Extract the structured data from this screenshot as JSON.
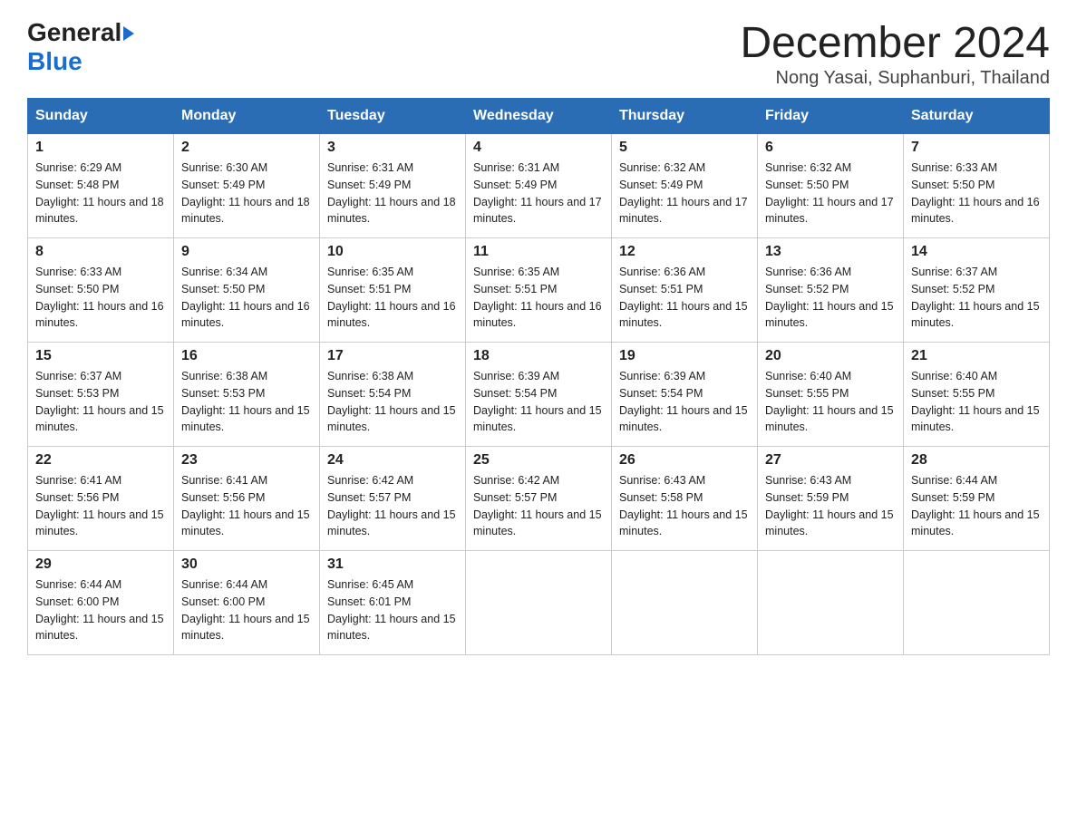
{
  "header": {
    "logo": {
      "general": "General",
      "blue": "Blue",
      "arrow": "▶"
    },
    "month_title": "December 2024",
    "location": "Nong Yasai, Suphanburi, Thailand"
  },
  "weekdays": [
    "Sunday",
    "Monday",
    "Tuesday",
    "Wednesday",
    "Thursday",
    "Friday",
    "Saturday"
  ],
  "weeks": [
    [
      {
        "day": "1",
        "sunrise": "6:29 AM",
        "sunset": "5:48 PM",
        "daylight": "11 hours and 18 minutes."
      },
      {
        "day": "2",
        "sunrise": "6:30 AM",
        "sunset": "5:49 PM",
        "daylight": "11 hours and 18 minutes."
      },
      {
        "day": "3",
        "sunrise": "6:31 AM",
        "sunset": "5:49 PM",
        "daylight": "11 hours and 18 minutes."
      },
      {
        "day": "4",
        "sunrise": "6:31 AM",
        "sunset": "5:49 PM",
        "daylight": "11 hours and 17 minutes."
      },
      {
        "day": "5",
        "sunrise": "6:32 AM",
        "sunset": "5:49 PM",
        "daylight": "11 hours and 17 minutes."
      },
      {
        "day": "6",
        "sunrise": "6:32 AM",
        "sunset": "5:50 PM",
        "daylight": "11 hours and 17 minutes."
      },
      {
        "day": "7",
        "sunrise": "6:33 AM",
        "sunset": "5:50 PM",
        "daylight": "11 hours and 16 minutes."
      }
    ],
    [
      {
        "day": "8",
        "sunrise": "6:33 AM",
        "sunset": "5:50 PM",
        "daylight": "11 hours and 16 minutes."
      },
      {
        "day": "9",
        "sunrise": "6:34 AM",
        "sunset": "5:50 PM",
        "daylight": "11 hours and 16 minutes."
      },
      {
        "day": "10",
        "sunrise": "6:35 AM",
        "sunset": "5:51 PM",
        "daylight": "11 hours and 16 minutes."
      },
      {
        "day": "11",
        "sunrise": "6:35 AM",
        "sunset": "5:51 PM",
        "daylight": "11 hours and 16 minutes."
      },
      {
        "day": "12",
        "sunrise": "6:36 AM",
        "sunset": "5:51 PM",
        "daylight": "11 hours and 15 minutes."
      },
      {
        "day": "13",
        "sunrise": "6:36 AM",
        "sunset": "5:52 PM",
        "daylight": "11 hours and 15 minutes."
      },
      {
        "day": "14",
        "sunrise": "6:37 AM",
        "sunset": "5:52 PM",
        "daylight": "11 hours and 15 minutes."
      }
    ],
    [
      {
        "day": "15",
        "sunrise": "6:37 AM",
        "sunset": "5:53 PM",
        "daylight": "11 hours and 15 minutes."
      },
      {
        "day": "16",
        "sunrise": "6:38 AM",
        "sunset": "5:53 PM",
        "daylight": "11 hours and 15 minutes."
      },
      {
        "day": "17",
        "sunrise": "6:38 AM",
        "sunset": "5:54 PM",
        "daylight": "11 hours and 15 minutes."
      },
      {
        "day": "18",
        "sunrise": "6:39 AM",
        "sunset": "5:54 PM",
        "daylight": "11 hours and 15 minutes."
      },
      {
        "day": "19",
        "sunrise": "6:39 AM",
        "sunset": "5:54 PM",
        "daylight": "11 hours and 15 minutes."
      },
      {
        "day": "20",
        "sunrise": "6:40 AM",
        "sunset": "5:55 PM",
        "daylight": "11 hours and 15 minutes."
      },
      {
        "day": "21",
        "sunrise": "6:40 AM",
        "sunset": "5:55 PM",
        "daylight": "11 hours and 15 minutes."
      }
    ],
    [
      {
        "day": "22",
        "sunrise": "6:41 AM",
        "sunset": "5:56 PM",
        "daylight": "11 hours and 15 minutes."
      },
      {
        "day": "23",
        "sunrise": "6:41 AM",
        "sunset": "5:56 PM",
        "daylight": "11 hours and 15 minutes."
      },
      {
        "day": "24",
        "sunrise": "6:42 AM",
        "sunset": "5:57 PM",
        "daylight": "11 hours and 15 minutes."
      },
      {
        "day": "25",
        "sunrise": "6:42 AM",
        "sunset": "5:57 PM",
        "daylight": "11 hours and 15 minutes."
      },
      {
        "day": "26",
        "sunrise": "6:43 AM",
        "sunset": "5:58 PM",
        "daylight": "11 hours and 15 minutes."
      },
      {
        "day": "27",
        "sunrise": "6:43 AM",
        "sunset": "5:59 PM",
        "daylight": "11 hours and 15 minutes."
      },
      {
        "day": "28",
        "sunrise": "6:44 AM",
        "sunset": "5:59 PM",
        "daylight": "11 hours and 15 minutes."
      }
    ],
    [
      {
        "day": "29",
        "sunrise": "6:44 AM",
        "sunset": "6:00 PM",
        "daylight": "11 hours and 15 minutes."
      },
      {
        "day": "30",
        "sunrise": "6:44 AM",
        "sunset": "6:00 PM",
        "daylight": "11 hours and 15 minutes."
      },
      {
        "day": "31",
        "sunrise": "6:45 AM",
        "sunset": "6:01 PM",
        "daylight": "11 hours and 15 minutes."
      },
      null,
      null,
      null,
      null
    ]
  ]
}
